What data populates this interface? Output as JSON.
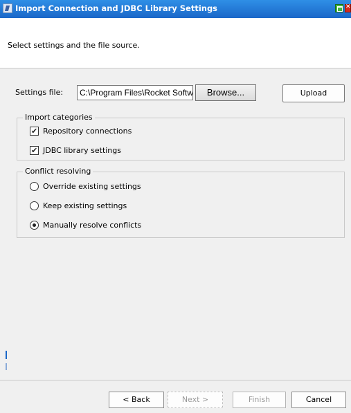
{
  "window": {
    "title": "Import Connection and JDBC Library Settings",
    "icons": {
      "app": "app-icon",
      "maximize": "maximize-icon",
      "close": "close-icon"
    }
  },
  "header": {
    "subtitle": "Select settings and the file source."
  },
  "settings": {
    "file_label": "Settings file:",
    "file_value": "C:\\Program Files\\Rocket Software\\",
    "browse_label": "Browse...",
    "upload_label": "Upload"
  },
  "import_categories": {
    "legend": "Import categories",
    "items": [
      {
        "label": "Repository connections",
        "checked": true
      },
      {
        "label": "JDBC library settings",
        "checked": true
      }
    ]
  },
  "conflict_resolving": {
    "legend": "Conflict resolving",
    "options": [
      {
        "label": "Override existing settings",
        "selected": false
      },
      {
        "label": "Keep existing settings",
        "selected": false
      },
      {
        "label": "Manually resolve conflicts",
        "selected": true
      }
    ]
  },
  "footer": {
    "back_label": "< Back",
    "next_label": "Next >",
    "finish_label": "Finish",
    "cancel_label": "Cancel"
  }
}
